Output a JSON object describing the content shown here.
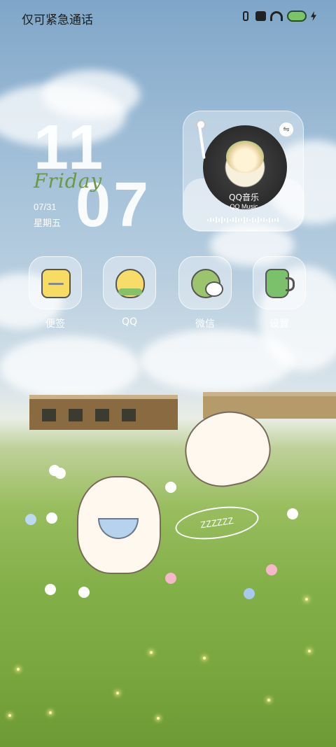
{
  "status_bar": {
    "left_text": "仅可紧急通话",
    "icons": [
      "vibrate-icon",
      "message-icon",
      "wifi-icon",
      "battery-icon",
      "charging-icon"
    ]
  },
  "clock": {
    "hour": "11",
    "minute": "07",
    "day_name": "Friday",
    "date": "07/31",
    "weekday": "星期五"
  },
  "music_widget": {
    "title": "QQ音乐",
    "subtitle": "QQ Music"
  },
  "apps": [
    {
      "label": "便签",
      "icon": "notes-icon"
    },
    {
      "label": "QQ",
      "icon": "qq-icon"
    },
    {
      "label": "微信",
      "icon": "wechat-icon"
    },
    {
      "label": "设置",
      "icon": "settings-icon"
    }
  ],
  "wallpaper": {
    "sleep_text": "ZZZZZZ"
  }
}
